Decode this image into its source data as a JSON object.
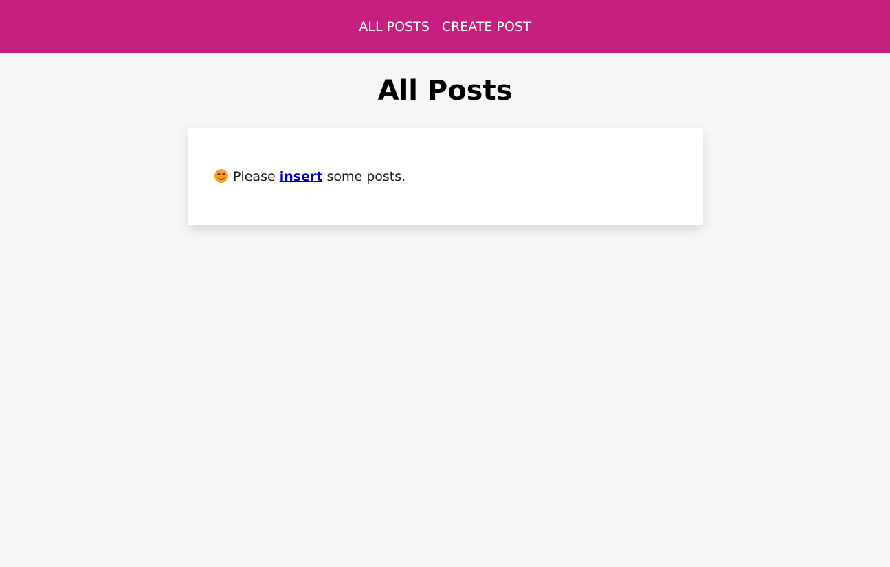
{
  "nav": {
    "items": [
      {
        "label": "ALL POSTS"
      },
      {
        "label": "CREATE POST"
      }
    ]
  },
  "page": {
    "title": "All Posts"
  },
  "empty_state": {
    "icon": "smiling-face-icon",
    "prefix": "Please",
    "link_text": "insert",
    "suffix": "some posts."
  },
  "colors": {
    "header_bg": "#c71f7f",
    "page_bg": "#f6f6f6",
    "link": "#0000cc"
  }
}
